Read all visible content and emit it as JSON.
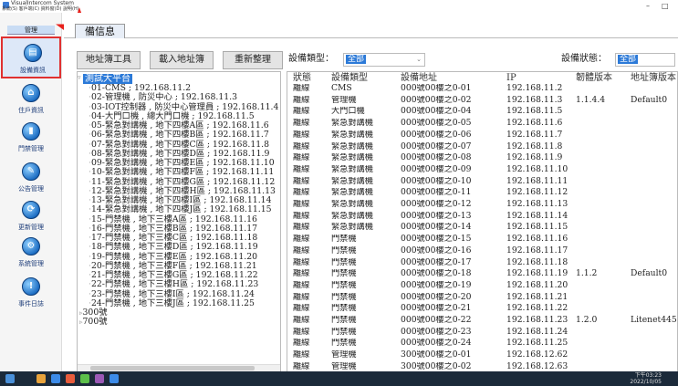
{
  "window": {
    "title": "VisualIntercom System",
    "menu": "系統(S)  客戶端(C)  資料窗(D)  說明(H)",
    "minimize": "–",
    "restore": "□"
  },
  "sidebar": {
    "top_label": "管理",
    "items": [
      {
        "label": "設備資訊",
        "icon": "device-info-icon",
        "glyph": "▤"
      },
      {
        "label": "住戶資訊",
        "icon": "resident-info-icon",
        "glyph": "⌂"
      },
      {
        "label": "門禁管理",
        "icon": "access-control-icon",
        "glyph": "▮"
      },
      {
        "label": "公告管理",
        "icon": "announcement-icon",
        "glyph": "✎"
      },
      {
        "label": "更新管理",
        "icon": "update-icon",
        "glyph": "⟳"
      },
      {
        "label": "系統管理",
        "icon": "system-icon",
        "glyph": "⚙"
      },
      {
        "label": "事件日誌",
        "icon": "event-log-icon",
        "glyph": "!"
      }
    ]
  },
  "tab": {
    "label": "備信息"
  },
  "toolbar": {
    "address_tool": "地址簿工具",
    "import_address": "載入地址簿",
    "reorganize": "重新整理"
  },
  "filters": {
    "type_label": "設備類型：",
    "type_value": "全部",
    "status_label": "設備狀態：",
    "status_value": "全部"
  },
  "tree": {
    "root": "測試大平台",
    "nodes": [
      "01-CMS ; 192.168.11.2",
      "02-管理機 , 防災中心 ; 192.168.11.3",
      "03-IOT控制器 , 防災中心管理員 ; 192.168.11.4",
      "04-大門口機 , 總大門口機 ; 192.168.11.5",
      "05-緊急對講機 , 地下四樓A區 ; 192.168.11.6",
      "06-緊急對講機 , 地下四樓B區 ; 192.168.11.7",
      "07-緊急對講機 , 地下四樓C區 ; 192.168.11.8",
      "08-緊急對講機 , 地下四樓D區 ; 192.168.11.9",
      "09-緊急對講機 , 地下四樓E區 ; 192.168.11.10",
      "10-緊急對講機 , 地下四樓F區 ; 192.168.11.11",
      "11-緊急對講機 , 地下四樓G區 ; 192.168.11.12",
      "12-緊急對講機 , 地下四樓H區 ; 192.168.11.13",
      "13-緊急對講機 , 地下四樓I區 ; 192.168.11.14",
      "14-緊急對講機 , 地下四樓J區 ; 192.168.11.15",
      "15-門禁機 , 地下三樓A區 ; 192.168.11.16",
      "16-門禁機 , 地下三樓B區 ; 192.168.11.17",
      "17-門禁機 , 地下三樓C區 ; 192.168.11.18",
      "18-門禁機 , 地下三樓D區 ; 192.168.11.19",
      "19-門禁機 , 地下三樓E區 ; 192.168.11.20",
      "20-門禁機 , 地下三樓F區 ; 192.168.11.21",
      "21-門禁機 , 地下三樓G區 ; 192.168.11.22",
      "22-門禁機 , 地下三樓H區 ; 192.168.11.23",
      "23-門禁機 , 地下三樓I區 ; 192.168.11.24",
      "24-門禁機 , 地下三樓J區 ; 192.168.11.25"
    ],
    "groups": [
      "300號",
      "700號"
    ]
  },
  "table": {
    "headers": [
      "狀態",
      "設備類型",
      "設備地址",
      "IP",
      "韌體版本",
      "地址簿版本"
    ],
    "rows": [
      [
        "離線",
        "CMS",
        "000號00樓之0-01",
        "192.168.11.2",
        "",
        ""
      ],
      [
        "離線",
        "管理機",
        "000號00樓之0-02",
        "192.168.11.3",
        "1.1.4.4",
        "Default0"
      ],
      [
        "離線",
        "大門口機",
        "000號00樓之0-04",
        "192.168.11.5",
        "",
        ""
      ],
      [
        "離線",
        "緊急對講機",
        "000號00樓之0-05",
        "192.168.11.6",
        "",
        ""
      ],
      [
        "離線",
        "緊急對講機",
        "000號00樓之0-06",
        "192.168.11.7",
        "",
        ""
      ],
      [
        "離線",
        "緊急對講機",
        "000號00樓之0-07",
        "192.168.11.8",
        "",
        ""
      ],
      [
        "離線",
        "緊急對講機",
        "000號00樓之0-08",
        "192.168.11.9",
        "",
        ""
      ],
      [
        "離線",
        "緊急對講機",
        "000號00樓之0-09",
        "192.168.11.10",
        "",
        ""
      ],
      [
        "離線",
        "緊急對講機",
        "000號00樓之0-10",
        "192.168.11.11",
        "",
        ""
      ],
      [
        "離線",
        "緊急對講機",
        "000號00樓之0-11",
        "192.168.11.12",
        "",
        ""
      ],
      [
        "離線",
        "緊急對講機",
        "000號00樓之0-12",
        "192.168.11.13",
        "",
        ""
      ],
      [
        "離線",
        "緊急對講機",
        "000號00樓之0-13",
        "192.168.11.14",
        "",
        ""
      ],
      [
        "離線",
        "緊急對講機",
        "000號00樓之0-14",
        "192.168.11.15",
        "",
        ""
      ],
      [
        "離線",
        "門禁機",
        "000號00樓之0-15",
        "192.168.11.16",
        "",
        ""
      ],
      [
        "離線",
        "門禁機",
        "000號00樓之0-16",
        "192.168.11.17",
        "",
        ""
      ],
      [
        "離線",
        "門禁機",
        "000號00樓之0-17",
        "192.168.11.18",
        "",
        ""
      ],
      [
        "離線",
        "門禁機",
        "000號00樓之0-18",
        "192.168.11.19",
        "1.1.2",
        "Default0"
      ],
      [
        "離線",
        "門禁機",
        "000號00樓之0-19",
        "192.168.11.20",
        "",
        ""
      ],
      [
        "離線",
        "門禁機",
        "000號00樓之0-20",
        "192.168.11.21",
        "",
        ""
      ],
      [
        "離線",
        "門禁機",
        "000號00樓之0-21",
        "192.168.11.22",
        "",
        ""
      ],
      [
        "離線",
        "門禁機",
        "000號00樓之0-22",
        "192.168.11.23",
        "1.2.0",
        "Litenet445"
      ],
      [
        "離線",
        "門禁機",
        "000號00樓之0-23",
        "192.168.11.24",
        "",
        ""
      ],
      [
        "離線",
        "門禁機",
        "000號00樓之0-24",
        "192.168.11.25",
        "",
        ""
      ],
      [
        "離線",
        "管理機",
        "300號00樓之0-01",
        "192.168.12.62",
        "",
        ""
      ],
      [
        "離線",
        "管理機",
        "300號00樓之0-02",
        "192.168.12.63",
        "",
        ""
      ]
    ]
  },
  "taskbar": {
    "time": "下午03:23",
    "date": "2022/10/05"
  },
  "colors": {
    "accent": "#2c7ad8",
    "highlight_border": "#e03030",
    "star": "#e8201b"
  }
}
